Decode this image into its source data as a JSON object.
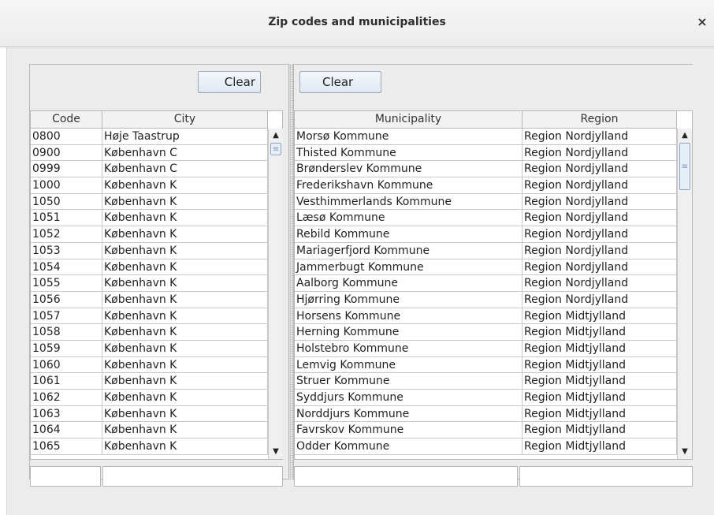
{
  "window": {
    "title": "Zip codes and municipalities",
    "close_glyph": "×"
  },
  "left": {
    "clear_label": "Clear",
    "headers": [
      "Code",
      "City"
    ],
    "rows": [
      [
        "0800",
        "Høje Taastrup"
      ],
      [
        "0900",
        "København C"
      ],
      [
        "0999",
        "København C"
      ],
      [
        "1000",
        "København K"
      ],
      [
        "1050",
        "København K"
      ],
      [
        "1051",
        "København K"
      ],
      [
        "1052",
        "København K"
      ],
      [
        "1053",
        "København K"
      ],
      [
        "1054",
        "København K"
      ],
      [
        "1055",
        "København K"
      ],
      [
        "1056",
        "København K"
      ],
      [
        "1057",
        "København K"
      ],
      [
        "1058",
        "København K"
      ],
      [
        "1059",
        "København K"
      ],
      [
        "1060",
        "København K"
      ],
      [
        "1061",
        "København K"
      ],
      [
        "1062",
        "København K"
      ],
      [
        "1063",
        "København K"
      ],
      [
        "1064",
        "København K"
      ],
      [
        "1065",
        "København K"
      ]
    ],
    "filters": [
      "",
      ""
    ],
    "scroll_position": 0.0
  },
  "right": {
    "clear_label": "Clear",
    "headers": [
      "Municipality",
      "Region"
    ],
    "rows": [
      [
        "Morsø Kommune",
        "Region Nordjylland"
      ],
      [
        "Thisted Kommune",
        "Region Nordjylland"
      ],
      [
        "Brønderslev Kommune",
        "Region Nordjylland"
      ],
      [
        "Frederikshavn Kommune",
        "Region Nordjylland"
      ],
      [
        "Vesthimmerlands Kommune",
        "Region Nordjylland"
      ],
      [
        "Læsø Kommune",
        "Region Nordjylland"
      ],
      [
        "Rebild Kommune",
        "Region Nordjylland"
      ],
      [
        "Mariagerfjord Kommune",
        "Region Nordjylland"
      ],
      [
        "Jammerbugt Kommune",
        "Region Nordjylland"
      ],
      [
        "Aalborg Kommune",
        "Region Nordjylland"
      ],
      [
        "Hjørring Kommune",
        "Region Nordjylland"
      ],
      [
        "Horsens Kommune",
        "Region Midtjylland"
      ],
      [
        "Herning Kommune",
        "Region Midtjylland"
      ],
      [
        "Holstebro Kommune",
        "Region Midtjylland"
      ],
      [
        "Lemvig Kommune",
        "Region Midtjylland"
      ],
      [
        "Struer Kommune",
        "Region Midtjylland"
      ],
      [
        "Syddjurs Kommune",
        "Region Midtjylland"
      ],
      [
        "Norddjurs Kommune",
        "Region Midtjylland"
      ],
      [
        "Favrskov Kommune",
        "Region Midtjylland"
      ],
      [
        "Odder Kommune",
        "Region Midtjylland"
      ]
    ],
    "filters": [
      "",
      ""
    ],
    "scroll_position": 0.0
  },
  "icons": {
    "scroll_up": "▲",
    "scroll_down": "▼",
    "grip": "≡"
  }
}
